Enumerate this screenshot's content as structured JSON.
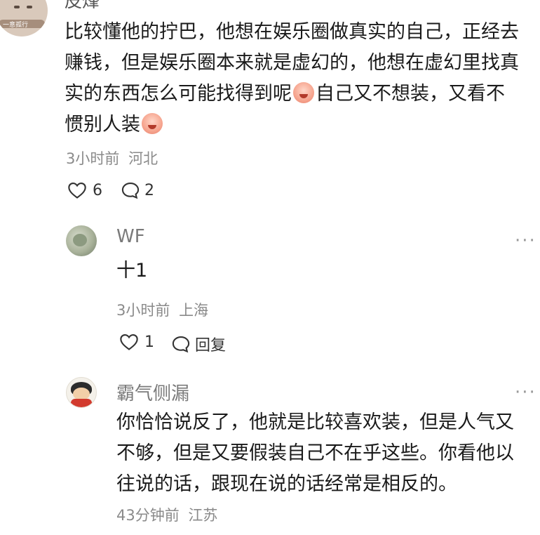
{
  "comment1": {
    "avatar_text": "一意孤行",
    "author": "皮烽",
    "text_line1": "比较懂他的拧巴，他想在娱乐圈做真实的自己，正经去",
    "text_line2": "赚钱，但是娱乐圈本来就是虚幻的，他想在虚幻里找真",
    "text_line3a": "实的东西怎么可能找得到呢",
    "text_line3b": "自己又不想装，又看不",
    "text_line4": "惯别人装",
    "time": "3小时前",
    "location": "河北",
    "likes": "6",
    "replies": "2"
  },
  "reply1": {
    "author": "WF",
    "text": "十1",
    "time": "3小时前",
    "location": "上海",
    "likes": "1",
    "reply_label": "回复",
    "more": "···"
  },
  "reply2": {
    "author": "霸气侧漏",
    "text_line1": "你恰恰说反了，他就是比较喜欢装，但是人气又",
    "text_line2": "不够，但是又要假装自己不在乎这些。你看他以",
    "text_line3": "往说的话，跟现在说的话经常是相反的。",
    "time": "43分钟前",
    "location": "江苏",
    "more": "···"
  },
  "icons": [
    "heart-icon",
    "comment-bubble-icon",
    "more-icon",
    "crying-emoji-icon"
  ]
}
